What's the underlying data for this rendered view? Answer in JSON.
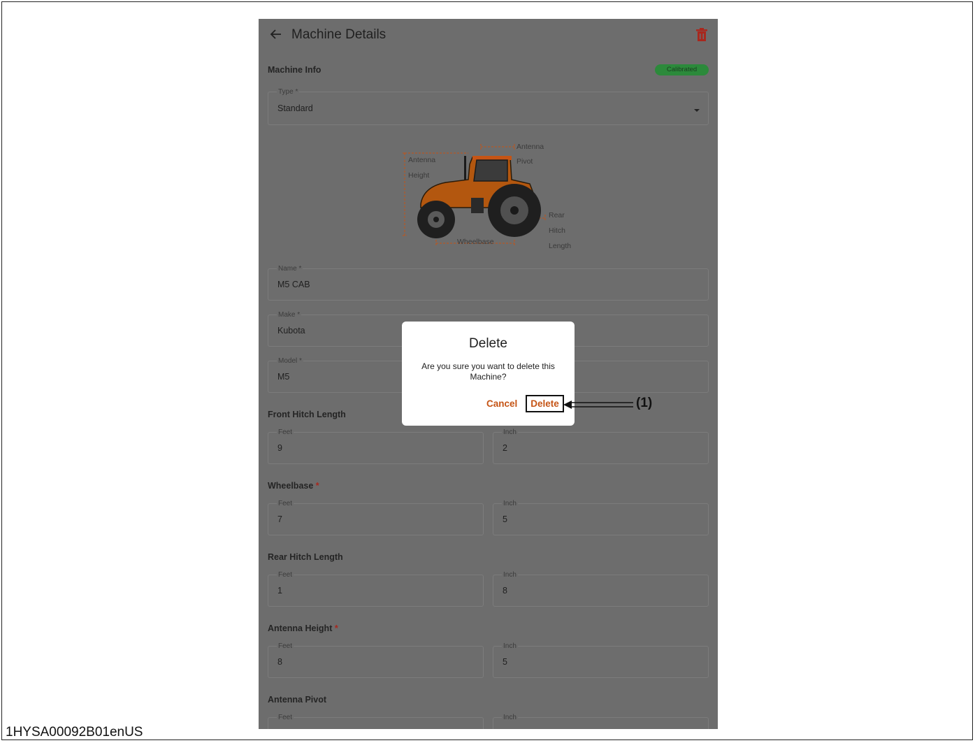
{
  "app": {
    "title": "Machine Details"
  },
  "machine_info": {
    "heading": "Machine Info",
    "status": "Calibrated",
    "type_label": "Type *",
    "type_value": "Standard"
  },
  "diagram": {
    "labels": {
      "antenna_height_1": "Antenna",
      "antenna_height_2": "Height",
      "antenna_pivot_1": "Antenna",
      "antenna_pivot_2": "Pivot",
      "rear_hitch_1": "Rear",
      "rear_hitch_2": "Hitch",
      "rear_hitch_3": "Length",
      "wheelbase": "Wheelbase"
    }
  },
  "fields": {
    "name": {
      "label": "Name *",
      "value": "M5 CAB"
    },
    "make": {
      "label": "Make *",
      "value": "Kubota"
    },
    "model": {
      "label": "Model *",
      "value": "M5"
    }
  },
  "measurements": [
    {
      "title": "Front Hitch Length",
      "required": "",
      "feet_label": "Feet",
      "feet": "9",
      "inch_label": "Inch",
      "inch": "2"
    },
    {
      "title": "Wheelbase",
      "required": "*",
      "feet_label": "Feet",
      "feet": "7",
      "inch_label": "Inch",
      "inch": "5"
    },
    {
      "title": "Rear Hitch Length",
      "required": "",
      "feet_label": "Feet",
      "feet": "1",
      "inch_label": "Inch",
      "inch": "8"
    },
    {
      "title": "Antenna Height",
      "required": "*",
      "feet_label": "Feet",
      "feet": "8",
      "inch_label": "Inch",
      "inch": "5"
    },
    {
      "title": "Antenna Pivot",
      "required": "",
      "feet_label": "Feet",
      "feet": "",
      "inch_label": "Inch",
      "inch": ""
    }
  ],
  "dialog": {
    "title": "Delete",
    "message": "Are you sure you want to delete this Machine?",
    "cancel_label": "Cancel",
    "delete_label": "Delete"
  },
  "callout": {
    "label": "(1)"
  },
  "document_code": "1HYSA00092B01enUS",
  "colors": {
    "accent": "#c55415",
    "status_green": "#2c8a3b",
    "overlay_gray": "#6d6d6d",
    "delete_icon": "#a8281e"
  }
}
